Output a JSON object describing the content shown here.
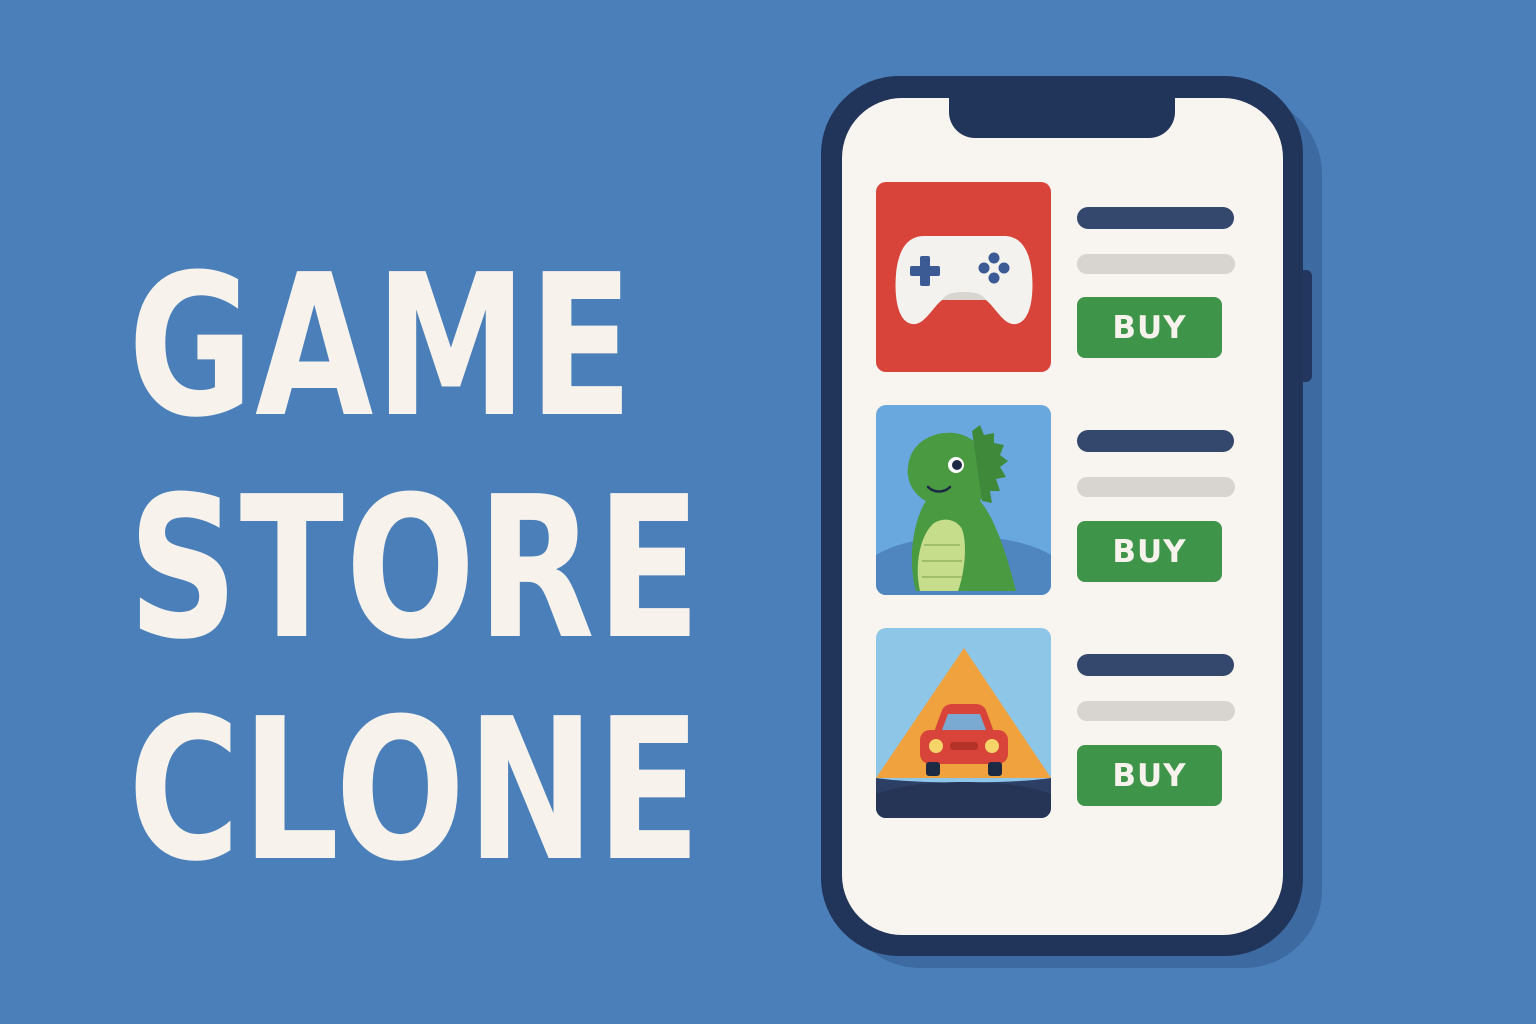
{
  "title": {
    "line1": "GAME",
    "line2": "STORE",
    "line3": "CLONE"
  },
  "store_items": [
    {
      "thumbnail": "gamepad-icon",
      "buy_label": "BUY"
    },
    {
      "thumbnail": "dinosaur-icon",
      "buy_label": "BUY"
    },
    {
      "thumbnail": "car-icon",
      "buy_label": "BUY"
    }
  ],
  "colors": {
    "background": "#4a7fb9",
    "phone_frame": "#213459",
    "screen": "#f8f5f0",
    "buy_button": "#3e9448",
    "title_text": "#f7f3ec",
    "thumb_gamepad_bg": "#d8443a",
    "thumb_dino_bg": "#69a8de",
    "thumb_car_bg": "#8ec6e8"
  }
}
